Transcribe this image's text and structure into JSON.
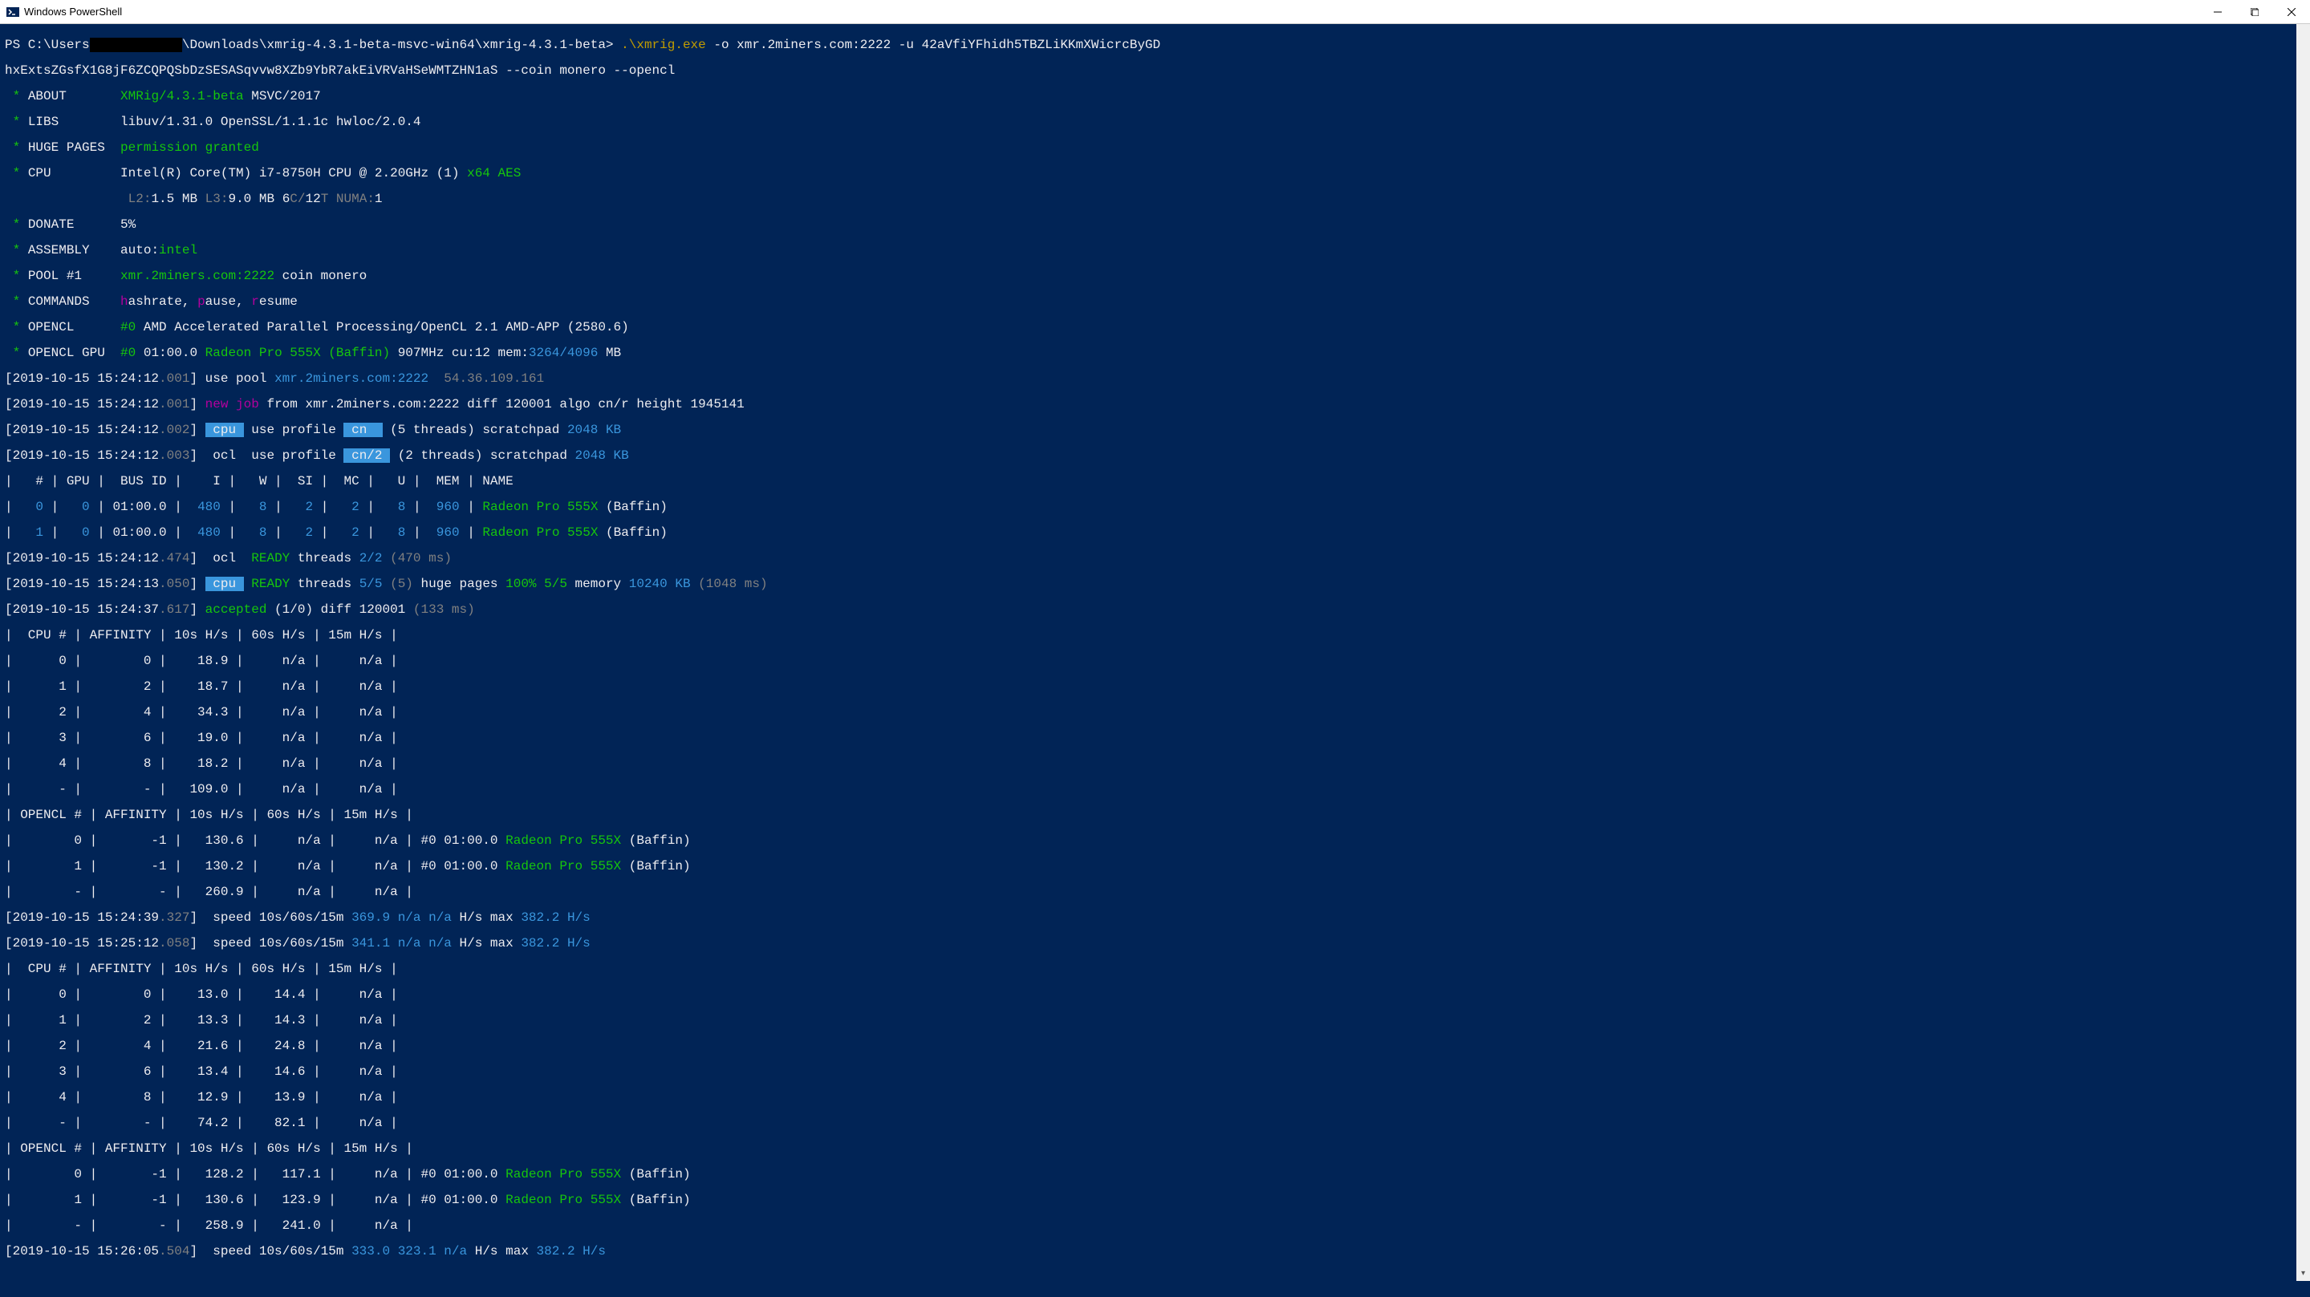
{
  "window": {
    "title": "Windows PowerShell"
  },
  "prompt": {
    "ps": "PS C:\\Users",
    "redacted": "            ",
    "path": "\\Downloads\\xmrig-4.3.1-beta-msvc-win64\\xmrig-4.3.1-beta> ",
    "cmd1": ".\\xmrig.exe",
    "cmd2": " -o ",
    "cmd3": "xmr.2miners.com:2222",
    "cmd4": " -u ",
    "cmd5": "42aVfiYFhidh5TBZLiKKmXWicrcByGD",
    "cmd6": "hxExtsZGsfX1G8jF6ZCQPQSbDzSESASqvvw8XZb9YbR7akEiVRVaHSeWMTZHN1aS --coin monero --opencl"
  },
  "lines": {
    "about_label": "ABOUT       ",
    "about_val": "XMRig/4.3.1-beta",
    "about_compiler": " MSVC/2017",
    "libs_label": "LIBS        ",
    "libs_val": "libuv/1.31.0 OpenSSL/1.1.1c hwloc/2.0.4",
    "huge_label": "HUGE PAGES  ",
    "huge_val": "permission granted",
    "cpu_label": "CPU         ",
    "cpu_val": "Intel(R) Core(TM) i7-8750H CPU @ 2.20GHz (1)",
    "cpu_x64": " x64 AES",
    "cpu_l2": "L2:",
    "cpu_l2v": "1.5 MB ",
    "cpu_l3": "L3:",
    "cpu_l3v": "9.0 MB ",
    "cpu_ct": "6",
    "cpu_slash": "C/",
    "cpu_tt": "12",
    "cpu_t": "T ",
    "cpu_numa": "NUMA:",
    "cpu_numav": "1",
    "donate_label": "DONATE      ",
    "donate_val": "5%",
    "asm_label": "ASSEMBLY    ",
    "asm_auto": "auto:",
    "asm_intel": "intel",
    "pool_label": "POOL #1     ",
    "pool_addr": "xmr.2miners.com:2222",
    "pool_coin": " coin monero",
    "cmds_label": "COMMANDS    ",
    "cmds_h": "h",
    "cmds_hr": "ashrate, ",
    "cmds_p": "p",
    "cmds_pa": "ause, ",
    "cmds_r": "r",
    "cmds_re": "esume",
    "ocl_label": "OPENCL      ",
    "ocl_dev": "#0",
    "ocl_plat": " AMD Accelerated Parallel Processing/OpenCL 2.1 AMD-APP (2580.6)",
    "oclgpu_label": "OPENCL GPU  ",
    "oclgpu_dev": "#0",
    "oclgpu_pci": " 01:00.0 ",
    "oclgpu_name": "Radeon Pro 555X (Baffin)",
    "oclgpu_mhz": " 907MHz cu:12 mem:",
    "oclgpu_mem": "3264/4096",
    "oclgpu_mb": " MB",
    "ts1": "[2019-10-15 15:24:12",
    "ts1ms": ".001",
    "ts1b": "] ",
    "usepool": "use pool ",
    "pooladdr": "xmr.2miners.com:2222  ",
    "poolip": "54.36.109.161",
    "newjob": "new job",
    "newjob_rest": " from xmr.2miners.com:2222 diff 120001 algo cn/r height 1945141",
    "ts2ms": ".002",
    "cputag": " cpu ",
    "useprof": " use profile ",
    "profcn": " cn  ",
    "threads5": " (5 threads) scratchpad ",
    "sp2048": "2048 KB",
    "ts3ms": ".003",
    "ocltag": " ocl ",
    "profcn2": " cn/2 ",
    "threads2": " (2 threads) scratchpad ",
    "gpuhdr": "|   # | GPU |  BUS ID |    I |   W |  SI |  MC |   U |  MEM | NAME",
    "gpurow0_a": "|   ",
    "gpurow0_idx": "0",
    "gpurow0_b": " |   ",
    "gpurow0_gpu": "0",
    "gpurow0_c": " | 01:00.0 |  ",
    "gpurow0_i": "480",
    "gpurow0_d": " |   ",
    "gpurow0_w": "8",
    "gpurow0_e": " |   ",
    "gpurow0_si": "2",
    "gpurow0_f": " |   ",
    "gpurow0_mc": "2",
    "gpurow0_g": " |   ",
    "gpurow0_u": "8",
    "gpurow0_h": " |  ",
    "gpurow0_mem": "960",
    "gpurow0_i2": " | ",
    "gpurow0_name": "Radeon Pro 555X",
    "gpurow0_baffin": " (Baffin)",
    "gpurow1_idx": "1",
    "ts474": ".474",
    "oclready": " READY ",
    "oclthreads": "threads ",
    "ocl22": "2/2",
    "ocl470": " (470 ms)",
    "ts13": "[2019-10-15 15:24:13",
    "ts050": ".050",
    "cpuready": "threads ",
    "cpu55": "5/5",
    "cpu5p": " (5)",
    "hugepg": " huge pages ",
    "hp100": "100% 5/5",
    "mem": " memory ",
    "mem10240": "10240 KB",
    "mem1048": " (1048 ms)",
    "ts37": "[2019-10-15 15:24:37",
    "ts617": ".617",
    "accepted": "accepted",
    "acc10": " (1/0) diff 120001 ",
    "acc133": "(133 ms)",
    "cpuhdr": "|  CPU # | AFFINITY | 10s H/s | 60s H/s | 15m H/s |",
    "cpu_r0": "|      0 |        0 |    18.9 |     n/a |     n/a |",
    "cpu_r1": "|      1 |        2 |    18.7 |     n/a |     n/a |",
    "cpu_r2": "|      2 |        4 |    34.3 |     n/a |     n/a |",
    "cpu_r3": "|      3 |        6 |    19.0 |     n/a |     n/a |",
    "cpu_r4": "|      4 |        8 |    18.2 |     n/a |     n/a |",
    "cpu_rt": "|      - |        - |   109.0 |     n/a |     n/a |",
    "oclhdr": "| OPENCL # | AFFINITY | 10s H/s | 60s H/s | 15m H/s |",
    "ocl_r0a": "|        0 |       -1 |   130.6 |     n/a |     n/a | ",
    "ocl_r0b": "#0 01:00.0 ",
    "ocl_name": "Radeon Pro 555X",
    "ocl_baf": " (Baffin)",
    "ocl_r1a": "|        1 |       -1 |   130.2 |     n/a |     n/a | ",
    "ocl_rt": "|        - |        - |   260.9 |     n/a |     n/a |",
    "ts39": "[2019-10-15 15:24:39",
    "ts327": ".327",
    "speed": " speed 10s/60s/15m ",
    "sp369": "369.9",
    "na": " n/a n/a",
    "hs": " H/s ",
    "max": "max ",
    "max382": "382.2 H/s",
    "ts2512": "[2019-10-15 15:25:12",
    "ts058": ".058",
    "sp341": "341.1",
    "cpu2_r0": "|      0 |        0 |    13.0 |    14.4 |     n/a |",
    "cpu2_r1": "|      1 |        2 |    13.3 |    14.3 |     n/a |",
    "cpu2_r2": "|      2 |        4 |    21.6 |    24.8 |     n/a |",
    "cpu2_r3": "|      3 |        6 |    13.4 |    14.6 |     n/a |",
    "cpu2_r4": "|      4 |        8 |    12.9 |    13.9 |     n/a |",
    "cpu2_rt": "|      - |        - |    74.2 |    82.1 |     n/a |",
    "ocl2_r0a": "|        0 |       -1 |   128.2 |   117.1 |     n/a | ",
    "ocl2_r1a": "|        1 |       -1 |   130.6 |   123.9 |     n/a | ",
    "ocl2_rt": "|        - |        - |   258.9 |   241.0 |     n/a |",
    "ts2605": "[2019-10-15 15:26:05",
    "ts504": ".504",
    "sp333": "333.0",
    "sp323": " 323.1",
    "na1": " n/a"
  }
}
